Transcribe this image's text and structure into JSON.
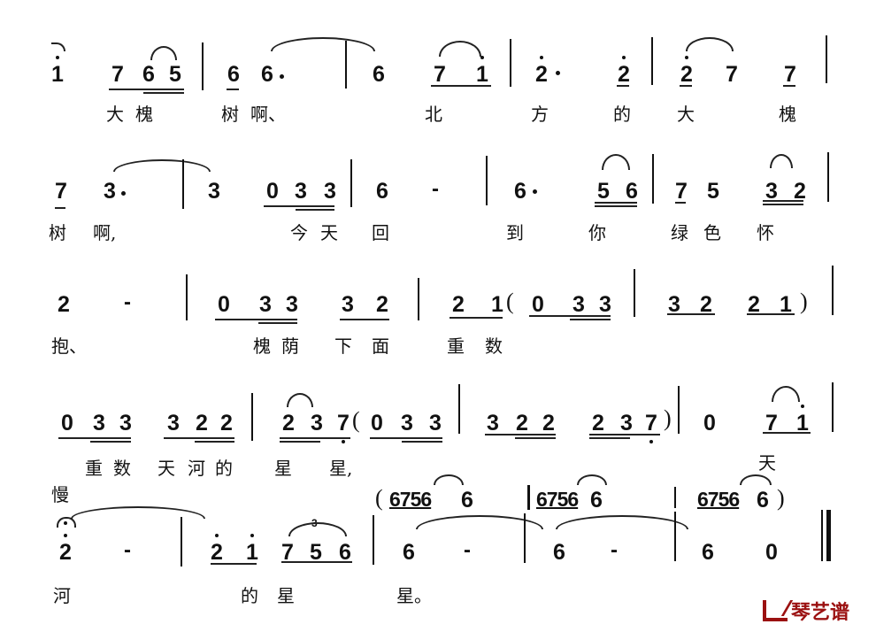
{
  "score": {
    "lines": [
      {
        "notation": "i 765 | 6 6· | 6 7 i | 2· 2 | 2 7 7 |",
        "notes": [
          "1̇",
          "7",
          "6",
          "5",
          "6",
          "6·",
          "6",
          "7",
          "1̇",
          "2̇·",
          "2̇",
          "2̇",
          "7",
          "7"
        ],
        "lyrics": [
          "大",
          "槐",
          "树",
          "啊、",
          "北",
          "方",
          "的",
          "大",
          "槐"
        ]
      },
      {
        "notation": "7 3· | 3 033 | 6 - | 6· 56 | 7 5 32 |",
        "notes": [
          "7",
          "3·",
          "3",
          "0",
          "3",
          "3",
          "6",
          "-",
          "6·",
          "5",
          "6",
          "7",
          "5",
          "3",
          "2"
        ],
        "lyrics": [
          "树",
          "啊,",
          "今",
          "天",
          "回",
          "到",
          "你",
          "绿",
          "色",
          "怀"
        ]
      },
      {
        "notation": "2 - | 033 32 | 21(033 | 3221) |",
        "notes": [
          "2",
          "-",
          "0",
          "3",
          "3",
          "3",
          "2",
          "2",
          "1",
          "(",
          "0",
          "3",
          "3",
          "3",
          "2",
          "2",
          "1",
          ")"
        ],
        "lyrics": [
          "抱、",
          "槐",
          "荫",
          "下",
          "面",
          "重",
          "数"
        ]
      },
      {
        "notation": "033 322 | 237(033 | 322 237) | 0 7i |",
        "notes": [
          "0",
          "3",
          "3",
          "3",
          "2",
          "2",
          "2",
          "3",
          "7",
          "(",
          "0",
          "3",
          "3",
          "3",
          "2",
          "2",
          "2",
          "3",
          "7",
          ")",
          "0",
          "7",
          "1̇"
        ],
        "lyrics": [
          "重",
          "数",
          "天",
          "河",
          "的",
          "星",
          "星,",
          "天"
        ]
      },
      {
        "tempo_mark": "慢",
        "upper_voice": "(6756 6 | 6756 6 | 6756 6)",
        "notation": "2 - | 2 i 756 | 6 - | 6 - | 6 0 ||",
        "notes": [
          "2̇",
          "-",
          "2̇",
          "1̇",
          "7",
          "5",
          "6",
          "6",
          "-",
          "6",
          "-",
          "6",
          "0"
        ],
        "lyrics": [
          "河",
          "的",
          "星",
          "星。"
        ]
      }
    ]
  },
  "labels": {
    "l1": {
      "a": "1",
      "b": "7",
      "c": "6",
      "d": "5",
      "e": "6",
      "f": "6",
      "g": "6",
      "h": "7",
      "i": "1",
      "j": "2",
      "k": "2",
      "l": "2",
      "m": "7",
      "n": "7"
    },
    "y1": {
      "a": "大",
      "b": "槐",
      "c": "树",
      "d": "啊、",
      "e": "北",
      "f": "方",
      "g": "的",
      "h": "大",
      "i": "槐"
    },
    "l2": {
      "a": "7",
      "b": "3",
      "c": "3",
      "d": "0",
      "e": "3",
      "f": "3",
      "g": "6",
      "h": "-",
      "i": "6",
      "j": "5",
      "k": "6",
      "l": "7",
      "m": "5",
      "n": "3",
      "o": "2"
    },
    "y2": {
      "a": "树",
      "b": "啊,",
      "c": "今",
      "d": "天",
      "e": "回",
      "f": "到",
      "g": "你",
      "h": "绿",
      "i": "色",
      "j": "怀"
    },
    "l3": {
      "a": "2",
      "b": "-",
      "c": "0",
      "d": "3",
      "e": "3",
      "f": "3",
      "g": "2",
      "h": "2",
      "i": "1",
      "j": "(",
      "k": "0",
      "l": "3",
      "m": "3",
      "n": "3",
      "o": "2",
      "p": "2",
      "q": "1",
      "r": ")"
    },
    "y3": {
      "a": "抱、",
      "b": "槐",
      "c": "荫",
      "d": "下",
      "e": "面",
      "f": "重",
      "g": "数"
    },
    "l4": {
      "a": "0",
      "b": "3",
      "c": "3",
      "d": "3",
      "e": "2",
      "f": "2",
      "g": "2",
      "h": "3",
      "i": "7",
      "j": "(",
      "k": "0",
      "l": "3",
      "m": "3",
      "n": "3",
      "o": "2",
      "p": "2",
      "q": "2",
      "r": "3",
      "s": "7",
      "t": ")",
      "u": "0",
      "v": "7",
      "w": "1"
    },
    "y4": {
      "a": "重",
      "b": "数",
      "c": "天",
      "d": "河",
      "e": "的",
      "f": "星",
      "g": "星,",
      "h": "天"
    },
    "l5": {
      "tempo": "慢",
      "p1": "(",
      "g1": "6756",
      "g1b": "6",
      "g2": "6756",
      "g2b": "6",
      "g3": "6756",
      "g3b": "6",
      "p2": ")",
      "a": "2",
      "b": "-",
      "c": "2",
      "d": "1",
      "e": "7",
      "f": "5",
      "g": "6",
      "h": "6",
      "i": "-",
      "j": "6",
      "k": "-",
      "l": "6",
      "m": "0",
      "trip": "3"
    },
    "y5": {
      "a": "河",
      "b": "的",
      "c": "星",
      "d": "星。"
    },
    "watermark": "琴艺谱"
  }
}
